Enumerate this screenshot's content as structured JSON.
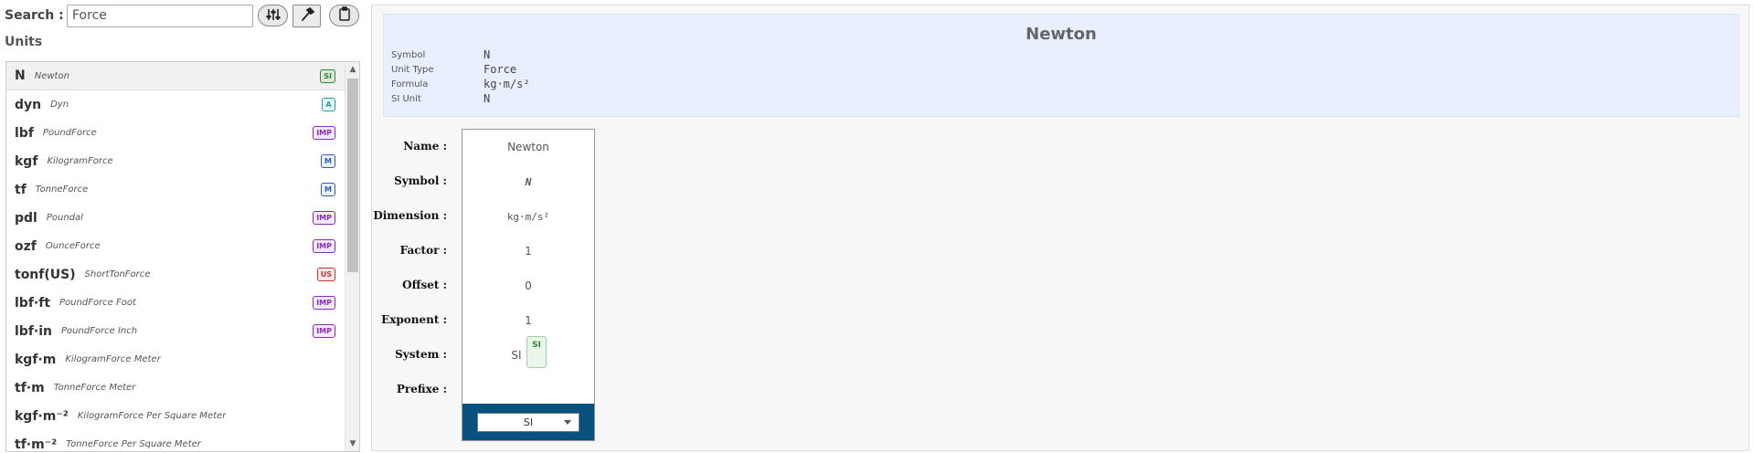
{
  "search": {
    "label": "Search :",
    "value": "Force"
  },
  "units_title": "Units",
  "units": [
    {
      "symbol": "N",
      "name": "Newton",
      "badge": "SI",
      "color": "#2d8a2d"
    },
    {
      "symbol": "dyn",
      "name": "Dyn",
      "badge": "A",
      "color": "#1aa6a6"
    },
    {
      "symbol": "lbf",
      "name": "PoundForce",
      "badge": "IMP",
      "color": "#8a2bc6"
    },
    {
      "symbol": "kgf",
      "name": "KilogramForce",
      "badge": "M",
      "color": "#2f5fb3"
    },
    {
      "symbol": "tf",
      "name": "TonneForce",
      "badge": "M",
      "color": "#2f5fb3"
    },
    {
      "symbol": "pdl",
      "name": "Poundal",
      "badge": "IMP",
      "color": "#8a2bc6"
    },
    {
      "symbol": "ozf",
      "name": "OunceForce",
      "badge": "IMP",
      "color": "#8a2bc6"
    },
    {
      "symbol": "tonf(US)",
      "name": "ShortTonForce",
      "badge": "US",
      "color": "#d22f2f"
    },
    {
      "symbol": "lbf·ft",
      "name": "PoundForce Foot",
      "badge": "IMP",
      "color": "#8a2bc6"
    },
    {
      "symbol": "lbf·in",
      "name": "PoundForce Inch",
      "badge": "IMP",
      "color": "#8a2bc6"
    },
    {
      "symbol": "kgf·m",
      "name": "KilogramForce Meter",
      "badge": "",
      "color": ""
    },
    {
      "symbol": "tf·m",
      "name": "TonneForce Meter",
      "badge": "",
      "color": ""
    },
    {
      "symbol": "kgf·m⁻²",
      "name": "KilogramForce Per Square Meter",
      "badge": "",
      "color": ""
    },
    {
      "symbol": "tf·m⁻²",
      "name": "TonneForce Per Square Meter",
      "badge": "",
      "color": ""
    }
  ],
  "detail": {
    "title": "Newton",
    "meta": [
      {
        "key": "Symbol",
        "value": "N"
      },
      {
        "key": "Unit Type",
        "value": "Force"
      },
      {
        "key": "Formula",
        "value": "kg·m/s²"
      },
      {
        "key": "SI Unit",
        "value": "N"
      }
    ],
    "labels": {
      "name": "Name :",
      "symbol": "Symbol :",
      "dimension": "Dimension :",
      "factor": "Factor :",
      "offset": "Offset :",
      "exponent": "Exponent :",
      "system": "System :",
      "prefixe": "Prefixe :"
    },
    "values": {
      "name": "Newton",
      "symbol": "N",
      "dimension": "kg·m/s²",
      "factor": "1",
      "offset": "0",
      "exponent": "1",
      "system": "SI",
      "system_badge": "SI",
      "prefixe": "SI"
    }
  }
}
